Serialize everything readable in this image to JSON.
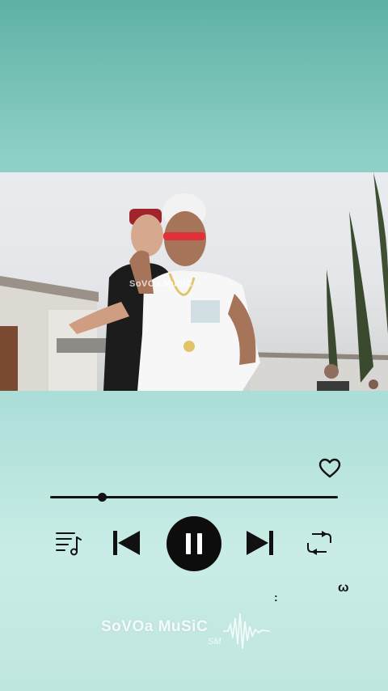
{
  "video": {
    "watermark": "SoVOa MuSiC"
  },
  "player": {
    "progress": 0.18,
    "state": "playing",
    "liked": false
  },
  "controls": {
    "playlist_icon": "playlist-icon",
    "previous_icon": "skip-previous-icon",
    "pause_icon": "pause-icon",
    "next_icon": "skip-next-icon",
    "repeat_icon": "repeat-icon",
    "favorite_icon": "heart-icon"
  },
  "decor": {
    "mark_colon": ":",
    "mark_omega": "ω"
  },
  "branding": {
    "name": "SoVOa MuSiC",
    "initials": "SM"
  },
  "colors": {
    "accent": "#111111",
    "background_top": "#5eb1a5",
    "background_bottom": "#c9ece6"
  }
}
